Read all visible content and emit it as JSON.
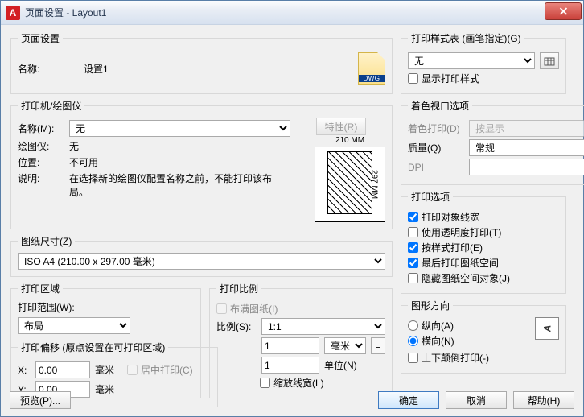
{
  "window": {
    "title": "页面设置 - Layout1"
  },
  "pageSetup": {
    "legend": "页面设置",
    "nameLabel": "名称:",
    "nameValue": "设置1",
    "dwgLabel": "DWG"
  },
  "printer": {
    "legend": "打印机/绘图仪",
    "nameLabel": "名称(M):",
    "nameValue": "无",
    "propertiesBtn": "特性(R)",
    "plotterLabel": "绘图仪:",
    "plotterValue": "无",
    "locationLabel": "位置:",
    "locationValue": "不可用",
    "descLabel": "说明:",
    "descValue": "在选择新的绘图仪配置名称之前，不能打印该布局。",
    "dimTop": "210 MM",
    "dimRight": "297 MM"
  },
  "paperSize": {
    "legend": "图纸尺寸(Z)",
    "value": "ISO A4 (210.00 x 297.00 毫米)"
  },
  "plotArea": {
    "legend": "打印区域",
    "rangeLabel": "打印范围(W):",
    "rangeValue": "布局"
  },
  "plotScale": {
    "legend": "打印比例",
    "fit": "布满图纸(I)",
    "scaleLabel": "比例(S):",
    "scaleValue": "1:1",
    "unitA": "1",
    "unitALabel": "毫米",
    "unitB": "1",
    "unitBLabel": "单位(N)",
    "scaleLw": "缩放线宽(L)"
  },
  "offset": {
    "legend": "打印偏移 (原点设置在可打印区域)",
    "xLabel": "X:",
    "xValue": "0.00",
    "xUnit": "毫米",
    "center": "居中打印(C)",
    "yLabel": "Y:",
    "yValue": "0.00",
    "yUnit": "毫米"
  },
  "styleTable": {
    "legend": "打印样式表 (画笔指定)(G)",
    "value": "无",
    "show": "显示打印样式"
  },
  "shaded": {
    "legend": "着色视口选项",
    "shadeLabel": "着色打印(D)",
    "shadeValue": "按显示",
    "qualityLabel": "质量(Q)",
    "qualityValue": "常规",
    "dpiLabel": "DPI"
  },
  "options": {
    "legend": "打印选项",
    "o1": "打印对象线宽",
    "o2": "使用透明度打印(T)",
    "o3": "按样式打印(E)",
    "o4": "最后打印图纸空间",
    "o5": "隐藏图纸空间对象(J)"
  },
  "orientation": {
    "legend": "图形方向",
    "portrait": "纵向(A)",
    "landscape": "横向(N)",
    "upside": "上下颠倒打印(-)",
    "iconChar": "A"
  },
  "footer": {
    "preview": "预览(P)...",
    "ok": "确定",
    "cancel": "取消",
    "help": "帮助(H)"
  }
}
